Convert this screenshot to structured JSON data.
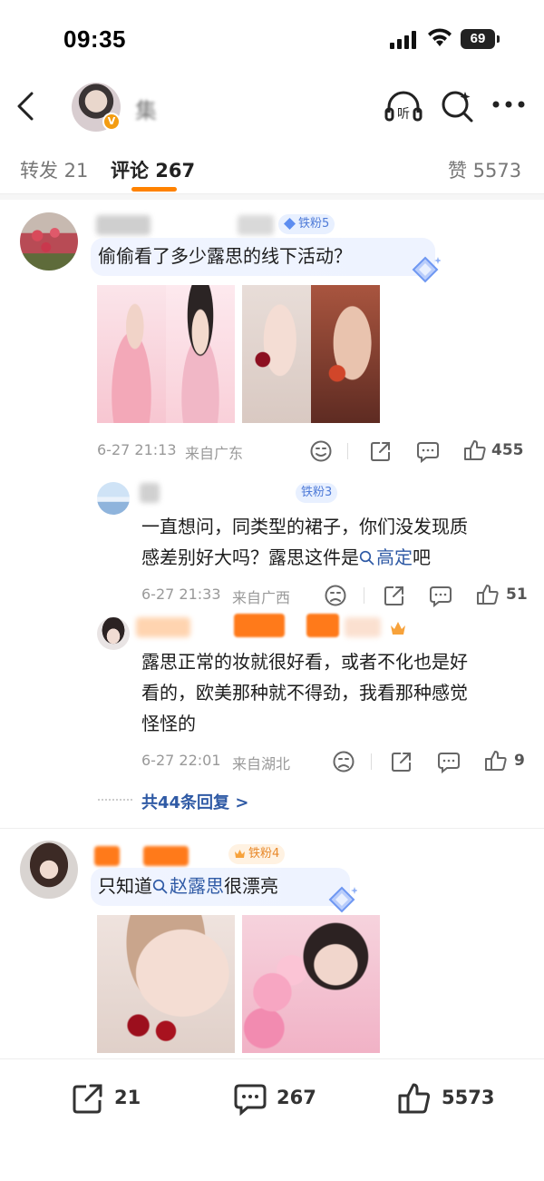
{
  "status": {
    "time": "09:35",
    "battery": "69"
  },
  "header": {
    "author": "集"
  },
  "tabs": {
    "repost": "转发 21",
    "comments": "评论 267",
    "likes": "赞 5573"
  },
  "comments": [
    {
      "badge": "铁粉5",
      "text": "偷偷看了多少露思的线下活动？",
      "time": "6-27 21:13",
      "location": "来自广东",
      "likes": "455",
      "replies": [
        {
          "name": "发",
          "badge": "铁粉3",
          "text_line1": "一直想问，同类型的裙子，你们没发现质",
          "text_line2_a": "感差别好大吗？露思这件是",
          "hashtag": "高定",
          "text_line2_b": "吧",
          "time": "6-27 21:33",
          "location": "来自广西",
          "likes": "51"
        },
        {
          "text_line1": "露思正常的妆就很好看，或者不化也是好",
          "text_line2": "看的，欧美那种就不得劲，我看那种感觉",
          "text_line3": "怪怪的",
          "time": "6-27 22:01",
          "location": "来自湖北",
          "likes": "9"
        }
      ],
      "more_replies": "共44条回复 >"
    },
    {
      "badge": "铁粉4",
      "text_a": "只知道",
      "hashtag": "赵露思",
      "text_b": "很漂亮"
    }
  ],
  "bottom_bar": {
    "repost": "21",
    "comment": "267",
    "like": "5573"
  },
  "colors": {
    "accent": "#ff8200",
    "link": "#2f5aa5",
    "badge_bg": "#e8f0ff"
  }
}
